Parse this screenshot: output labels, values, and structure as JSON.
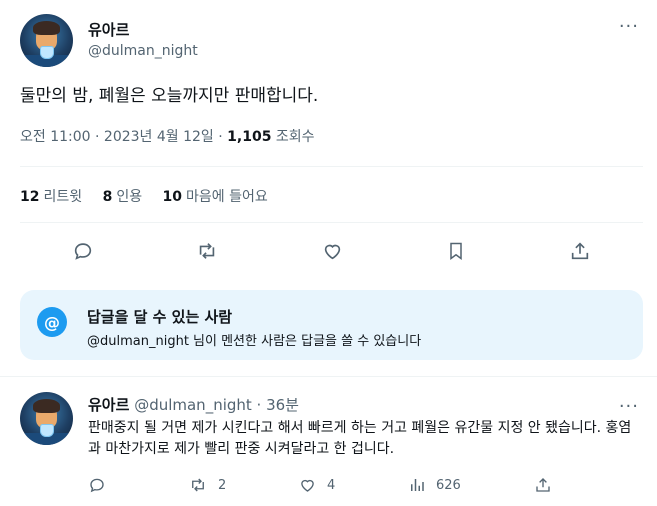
{
  "tweet": {
    "author_name": "유아르",
    "author_handle": "@dulman_night",
    "more_glyph": "···",
    "text": "둘만의 밤, 폐월은 오늘까지만 판매합니다.",
    "timestamp": "오전 11:00 · 2023년 4월 12일 · ",
    "views_count": "1,105",
    "views_label": " 조회수"
  },
  "stats": {
    "retweets_count": "12",
    "retweets_label": "리트윗",
    "quotes_count": "8",
    "quotes_label": "인용",
    "likes_count": "10",
    "likes_label": "마음에 들어요"
  },
  "reply_restriction": {
    "icon_glyph": "@",
    "title": "답글을 달 수 있는 사람",
    "subtitle": "@dulman_night 님이 멘션한 사람은 답글을 쓸 수 있습니다"
  },
  "reply": {
    "author_name": "유아르",
    "author_handle_time": "@dulman_night · 36분",
    "text": "판매중지 될 거면 제가 시킨다고 해서 빠르게 하는 거고 폐월은 유간물 지정 안 됐습니다. 홍염과 마찬가지로 제가 빨리 판중 시켜달라고 한 겁니다.",
    "retweets": "2",
    "likes": "4",
    "views": "626"
  },
  "colors": {
    "accent": "#1d9bf0",
    "secondary_text": "#536471",
    "reply_box_bg": "#e8f5fd"
  },
  "icons": [
    "reply-icon",
    "retweet-icon",
    "like-icon",
    "bookmark-icon",
    "share-icon",
    "views-icon",
    "at-sign-icon",
    "more-icon"
  ]
}
